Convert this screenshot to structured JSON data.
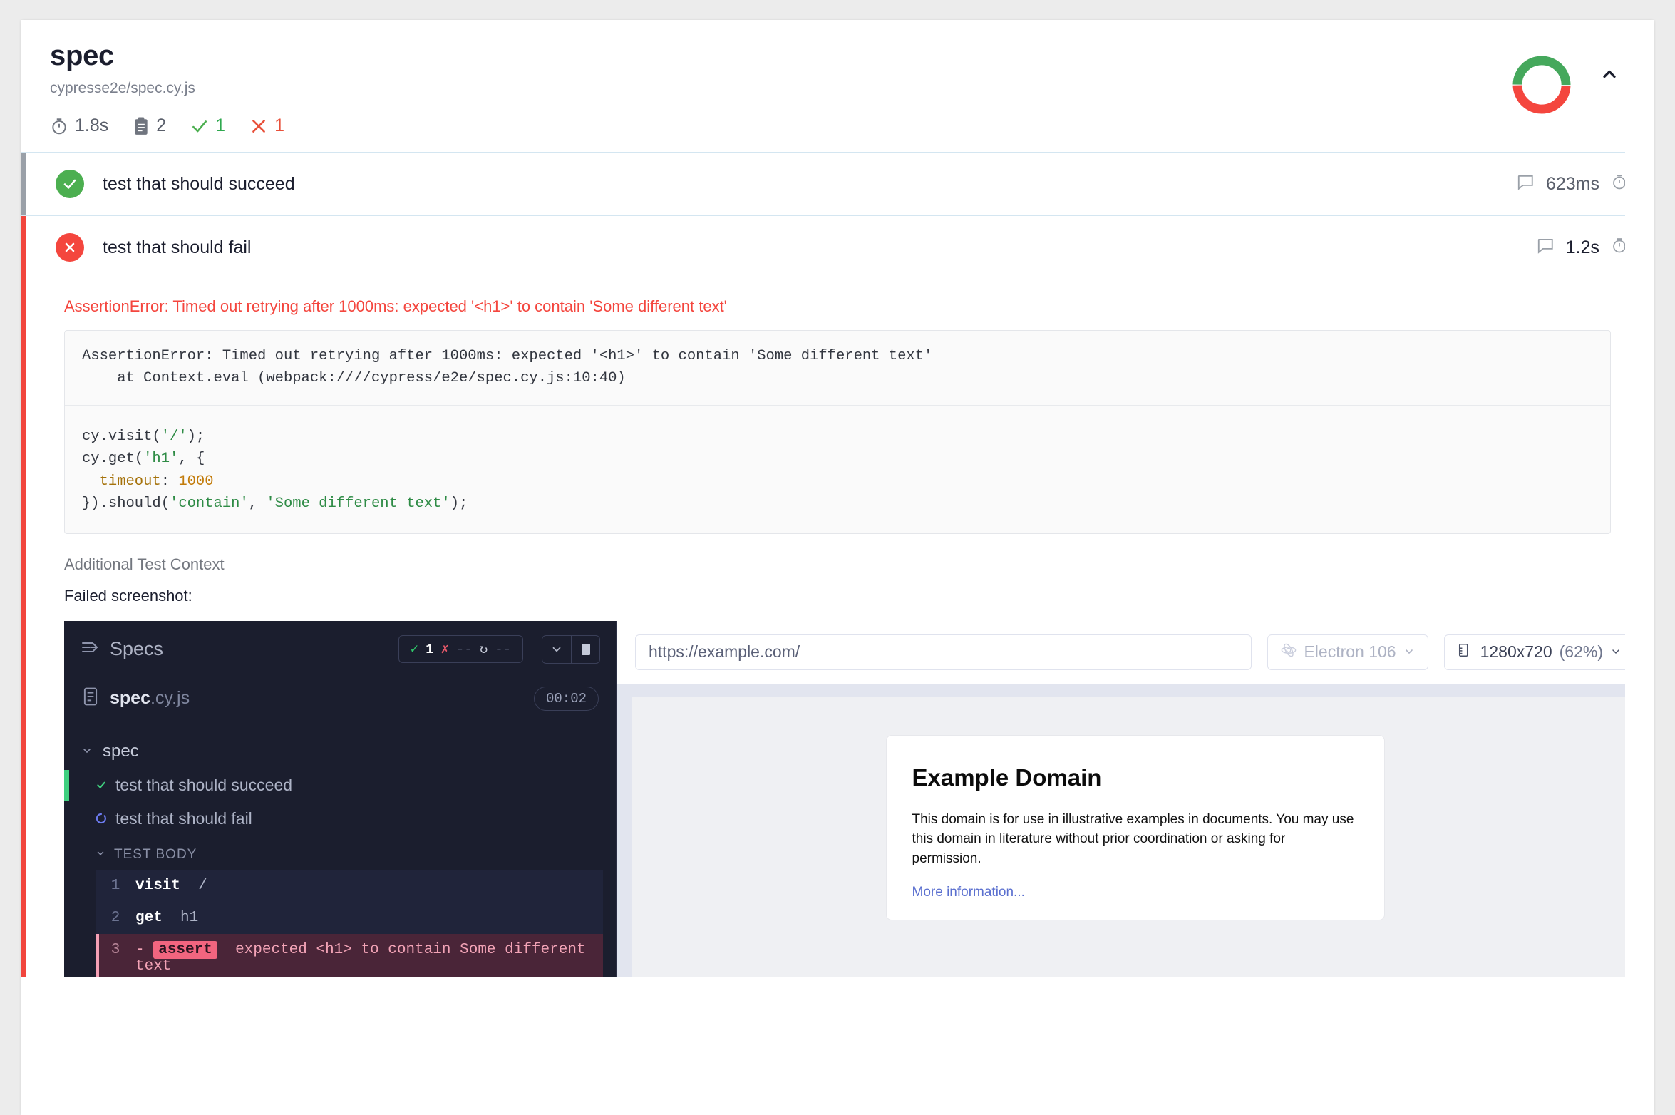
{
  "spec": {
    "title": "spec",
    "path": "cypresse2e/spec.cy.js",
    "stats": {
      "duration": "1.8s",
      "tests": "2",
      "passed": "1",
      "failed": "1"
    },
    "donut": {
      "pass_color": "#45A85C",
      "fail_color": "#F4463E",
      "pass_fraction": 0.5
    },
    "collapse_icon": "chevron-up-icon"
  },
  "tests": [
    {
      "name": "test that should succeed",
      "status": "passed",
      "duration": "623ms",
      "comment_icon": "comment-icon",
      "timer_icon": "stopwatch-icon"
    },
    {
      "name": "test that should fail",
      "status": "failed",
      "duration": "1.2s",
      "comment_icon": "comment-icon",
      "timer_icon": "stopwatch-icon"
    }
  ],
  "failure": {
    "error_line": "AssertionError: Timed out retrying after 1000ms: expected '<h1>' to contain 'Some different text'",
    "stack": "AssertionError: Timed out retrying after 1000ms: expected '<h1>' to contain 'Some different text'\n    at Context.eval (webpack:////cypress/e2e/spec.cy.js:10:40)",
    "code": {
      "l1": "cy.visit(",
      "l1_str": "'/'",
      "l1_end": ");",
      "l2": "cy.get(",
      "l2_str": "'h1'",
      "l2_end": ", {",
      "l3_key": "  timeout",
      "l3_sep": ": ",
      "l3_num": "1000",
      "l4_start": "}).should(",
      "l4_s1": "'contain'",
      "l4_mid": ", ",
      "l4_s2": "'Some different text'",
      "l4_end": ");"
    },
    "context_title": "Additional Test Context",
    "context_sub": "Failed screenshot:"
  },
  "screenshot": {
    "reporter": {
      "panel_icon": "specs-panel-icon",
      "label": "Specs",
      "stats": {
        "pass_icon": "check-icon",
        "pass": "1",
        "fail_icon": "x-icon",
        "fail": "--",
        "pending_icon": "circle-dashed-icon",
        "pending": "--"
      },
      "controls": [
        {
          "name": "chevron-down-icon"
        },
        {
          "name": "stop-icon"
        }
      ],
      "spec_file": {
        "file_icon": "file-icon",
        "name_bold": "spec",
        "name_rest": ".cy.js",
        "time": "00:02"
      },
      "tree": {
        "suite": "spec",
        "suite_chevron": "chevron-down-icon",
        "tests": [
          {
            "icon": "check-icon",
            "label": "test that should succeed",
            "state": "passed"
          },
          {
            "icon": "spinner-icon",
            "label": "test that should fail",
            "state": "running"
          }
        ],
        "body_label": "TEST BODY",
        "body_chevron": "chevron-down-icon",
        "commands": [
          {
            "num": "1",
            "name": "visit",
            "arg": "/",
            "state": "ok"
          },
          {
            "num": "2",
            "name": "get",
            "arg": "h1",
            "state": "ok"
          },
          {
            "num": "3",
            "prefix": "-",
            "chip": "assert",
            "text": "expected <h1> to contain Some different text",
            "state": "error"
          }
        ]
      }
    },
    "browser": {
      "url": "https://example.com/",
      "browser_icon": "electron-icon",
      "browser_label": "Electron 106",
      "browser_chevron": "chevron-down-icon",
      "viewport_icon": "ruler-icon",
      "viewport": "1280x720",
      "viewport_scale": "(62%)",
      "viewport_chevron": "chevron-down-icon"
    },
    "aut": {
      "heading": "Example Domain",
      "paragraph": "This domain is for use in illustrative examples in documents. You may use this domain in literature without prior coordination or asking for permission.",
      "link": "More information..."
    }
  }
}
